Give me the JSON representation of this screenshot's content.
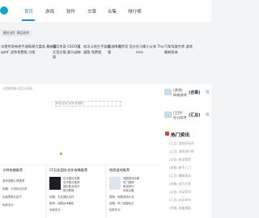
{
  "nav": {
    "items": [
      "首页",
      "游戏",
      "软件",
      "文章",
      "合集",
      "排行榜"
    ]
  },
  "tags": [
    "模仿动作",
    "精品软件"
  ],
  "featured": [
    {
      "text": "冰雪传奇神途手游lightF 战争免费版"
    },
    {
      "text": "网易大富翁 最新官方版"
    },
    {
      "text": "魔兵传奇 CSGO魔兵官方版 超凡战神版"
    },
    {
      "text": "欢乐斗地主手游极速版 免费版"
    },
    {
      "text": "西游降魔传奇 官方版"
    },
    {
      "text": "托马斯小火车 Thomas"
    },
    {
      "text": "汽车驾驶大师 游戏 最新版本"
    }
  ],
  "main": {
    "note": "问游戏来卡怎么弄呀",
    "banner_alt": "单机游戏/游戏专题图"
  },
  "side": {
    "items": [
      {
        "text": "(游戏)",
        "sub": "网络游戏",
        "title": "(合集)",
        "badge": "游"
      },
      {
        "text": "(工作)",
        "sub": "办公软件",
        "title": "(汇总)",
        "badge": "游"
      }
    ]
  },
  "hot": {
    "title": "热门资讯",
    "lines": [
      "(汇总)  游戏好玩的",
      "(汇总)  游戏排行榜",
      "(公告)  新游推荐",
      "(攻略)  新手入门",
      "(汇总)  最新版本",
      "(攻略)  技巧分享",
      "(公告)  活动资讯",
      "(汇总)  必玩单机",
      "(攻略)  装备搭配"
    ]
  },
  "bottom": [
    {
      "title": "卡特攻略推荐",
      "lines": [
        "游戏攻略心得推荐",
        "攻略：卡特玩法分享",
        "出装思路与技巧",
        "玩家评分："
      ]
    },
    {
      "title": "CF石化团队合作攻略推荐",
      "text": [
        "石化团队攻略",
        "合作模式推荐",
        "团队配合技巧",
        "新手教程"
      ],
      "lines": [
        "攻略：石化团队合作",
        "推荐：地图战术解析",
        "玩家评分："
      ]
    },
    {
      "title": "地图游戏推荐",
      "text": [
        "地图游戏合集",
        "热门推荐",
        "新游排行",
        "玩家必备"
      ],
      "lines": [
        "推荐：地图游戏大全",
        "攻略：热门地图玩法",
        "玩家评分："
      ]
    }
  ]
}
